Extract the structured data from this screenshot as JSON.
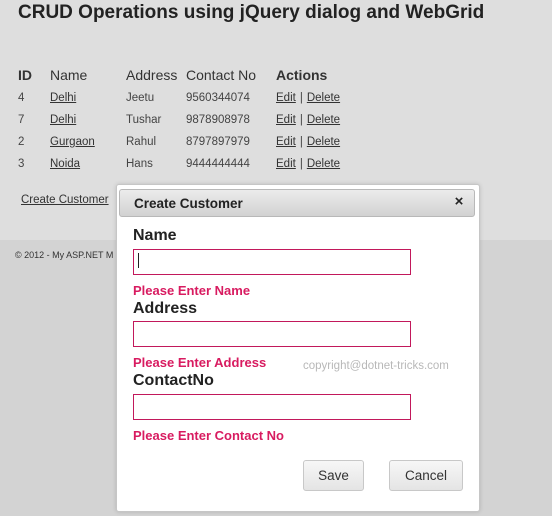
{
  "page": {
    "title": "CRUD Operations using jQuery dialog and WebGrid",
    "footer": "© 2012 - My ASP.NET M",
    "watermark": "copyright@dotnet-tricks.com",
    "create_link": "Create Customer"
  },
  "grid": {
    "headers": [
      "ID",
      "Name",
      "Address",
      "Contact No",
      "Actions"
    ],
    "rows": [
      {
        "id": "4",
        "name": "Delhi",
        "address": "Jeetu",
        "contact": "9560344074"
      },
      {
        "id": "7",
        "name": "Delhi",
        "address": "Tushar",
        "contact": "9878908978"
      },
      {
        "id": "2",
        "name": "Gurgaon",
        "address": "Rahul",
        "contact": "8797897979"
      },
      {
        "id": "3",
        "name": "Noida",
        "address": "Hans",
        "contact": "9444444444"
      }
    ],
    "edit_label": "Edit",
    "delete_label": "Delete",
    "separator": "|"
  },
  "dialog": {
    "title": "Create Customer",
    "close_glyph": "×",
    "fields": [
      {
        "label": "Name",
        "value": "",
        "error": "Please Enter Name"
      },
      {
        "label": "Address",
        "value": "",
        "error": "Please Enter Address"
      },
      {
        "label": "ContactNo",
        "value": "",
        "error": "Please Enter Contact No"
      }
    ],
    "save_label": "Save",
    "cancel_label": "Cancel"
  },
  "colors": {
    "error": "#d81b60",
    "input_border": "#c2185b"
  }
}
